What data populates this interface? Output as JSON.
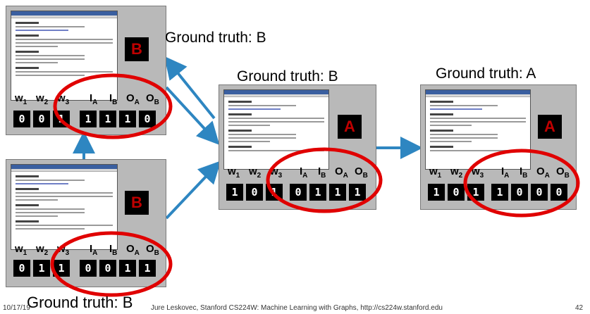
{
  "nodes": [
    {
      "label": "B",
      "var_headers": [
        "w",
        "w",
        "w",
        "I",
        "I",
        "O",
        "O"
      ],
      "var_subs": [
        "1",
        "2",
        "3",
        "A",
        "B",
        "A",
        "B"
      ],
      "bits_w": [
        "0",
        "0",
        "1"
      ],
      "bits_rel": [
        "1",
        "1",
        "1",
        "0"
      ]
    },
    {
      "label": "B",
      "var_headers": [
        "w",
        "w",
        "w",
        "I",
        "I",
        "O",
        "O"
      ],
      "var_subs": [
        "1",
        "2",
        "3",
        "A",
        "B",
        "A",
        "B"
      ],
      "bits_w": [
        "0",
        "1",
        "1"
      ],
      "bits_rel": [
        "0",
        "0",
        "1",
        "1"
      ]
    },
    {
      "label": "A",
      "var_headers": [
        "w",
        "w",
        "w",
        "I",
        "I",
        "O",
        "O"
      ],
      "var_subs": [
        "1",
        "2",
        "3",
        "A",
        "B",
        "A",
        "B"
      ],
      "bits_w": [
        "1",
        "0",
        "1"
      ],
      "bits_rel": [
        "0",
        "1",
        "1",
        "1"
      ]
    },
    {
      "label": "A",
      "var_headers": [
        "w",
        "w",
        "w",
        "I",
        "I",
        "O",
        "O"
      ],
      "var_subs": [
        "1",
        "2",
        "3",
        "A",
        "B",
        "A",
        "B"
      ],
      "bits_w": [
        "1",
        "0",
        "1"
      ],
      "bits_rel": [
        "1",
        "0",
        "0",
        "0"
      ]
    }
  ],
  "ground_truth": [
    "Ground truth: B",
    "Ground truth: B",
    "Ground truth: A",
    "Ground truth: B"
  ],
  "footer": {
    "date": "10/17/19",
    "credit": "Jure Leskovec, Stanford CS224W: Machine Learning with Graphs, http://cs224w.stanford.edu",
    "page": "42"
  },
  "colors": {
    "arrow": "#2e86c1",
    "ellipse": "#e00000",
    "label_text": "#c00000"
  }
}
